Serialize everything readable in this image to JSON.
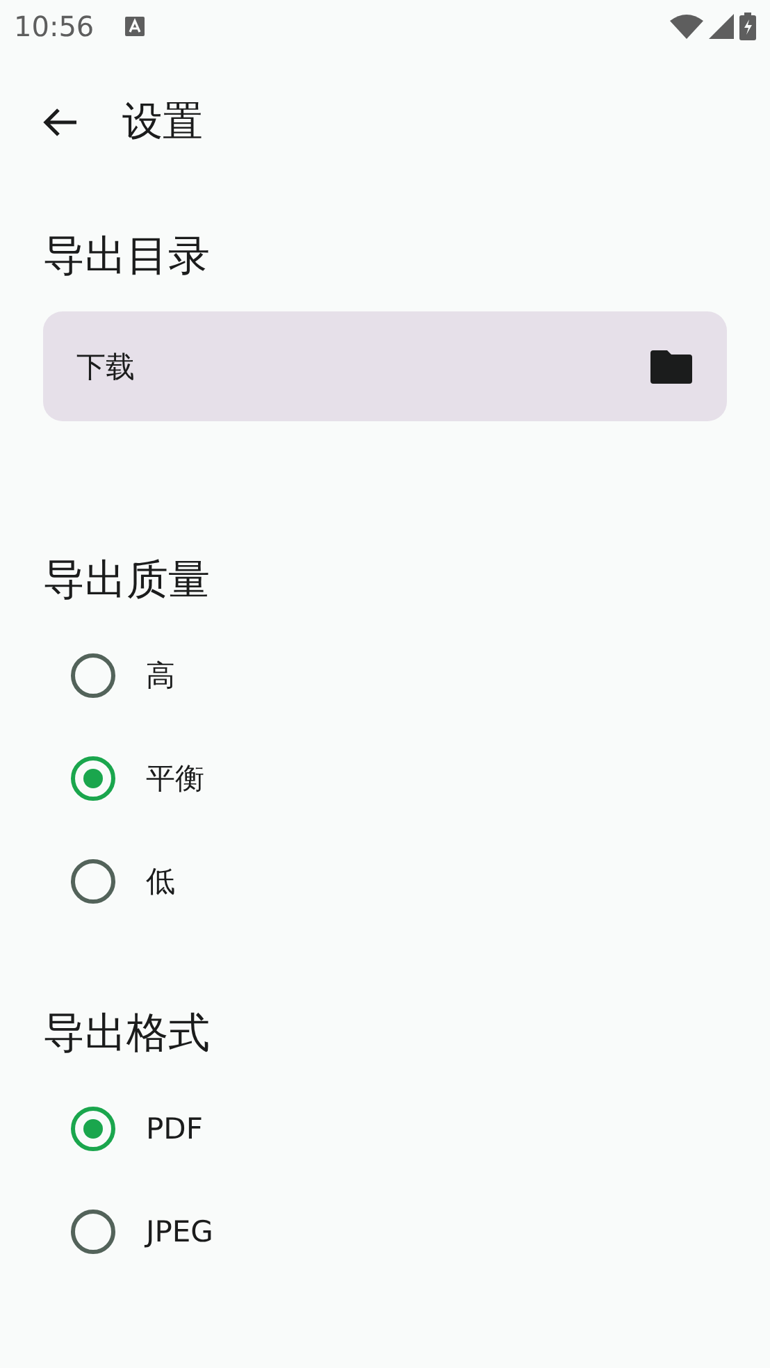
{
  "status_bar": {
    "time": "10:56"
  },
  "app_bar": {
    "title": "设置"
  },
  "sections": [
    {
      "kind": "folder",
      "title": "导出目录",
      "value": "下载"
    },
    {
      "kind": "radio",
      "title": "导出质量",
      "options": [
        {
          "label": "高",
          "selected": false
        },
        {
          "label": "平衡",
          "selected": true
        },
        {
          "label": "低",
          "selected": false
        }
      ]
    },
    {
      "kind": "radio",
      "title": "导出格式",
      "options": [
        {
          "label": "PDF",
          "selected": true
        },
        {
          "label": "JPEG",
          "selected": false
        }
      ]
    }
  ]
}
